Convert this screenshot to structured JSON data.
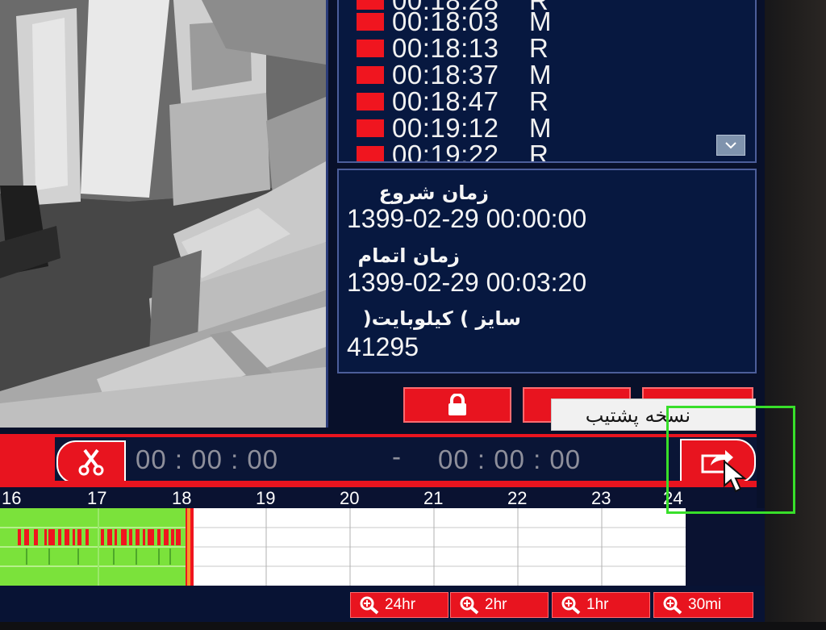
{
  "events": [
    {
      "time": "00:18:03",
      "type": "M"
    },
    {
      "time": "00:18:13",
      "type": "R"
    },
    {
      "time": "00:18:37",
      "type": "M"
    },
    {
      "time": "00:18:47",
      "type": "R"
    },
    {
      "time": "00:19:12",
      "type": "M"
    }
  ],
  "info": {
    "start_label": "زمان شروع",
    "start_value": "1399-02-29 00:00:00",
    "end_label": "زمان اتمام",
    "end_value": "1399-02-29 00:03:20",
    "size_label": "سایز ) کیلوبایت(",
    "size_value": "41295"
  },
  "tooltip": "نسخه پشتیب",
  "clip": {
    "start": "00 : 00 : 00",
    "separator": "-",
    "end": "00 : 00 : 00"
  },
  "timeline": {
    "hours": [
      "16",
      "17",
      "18",
      "19",
      "20",
      "21",
      "22",
      "23",
      "24"
    ]
  },
  "zoom": [
    "24hr",
    "2hr",
    "1hr",
    "30mi"
  ],
  "colors": {
    "record_motion": "#f0151f",
    "record_normal": "#7be23b",
    "accent": "#e8141f",
    "highlight": "#38df2a"
  }
}
